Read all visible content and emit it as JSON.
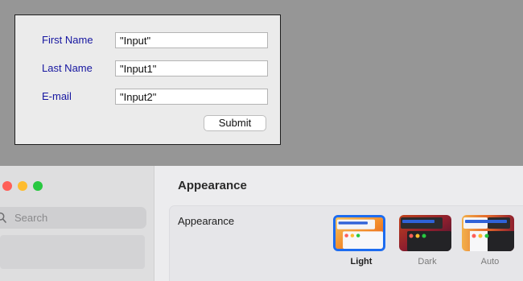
{
  "form": {
    "fields": [
      {
        "label": "First Name",
        "value": "\"Input\""
      },
      {
        "label": "Last Name",
        "value": "\"Input1\""
      },
      {
        "label": "E-mail",
        "value": "\"Input2\""
      }
    ],
    "submit_label": "Submit"
  },
  "settings": {
    "search_placeholder": "Search",
    "title": "Appearance",
    "appearance_label": "Appearance",
    "options": [
      {
        "label": "Light",
        "selected": true
      },
      {
        "label": "Dark",
        "selected": false
      },
      {
        "label": "Auto",
        "selected": false
      }
    ],
    "colors": {
      "accent": "#1d6cf0",
      "form_label": "#1616a0",
      "traffic_red": "#ff5f57",
      "traffic_yellow": "#febc2e",
      "traffic_green": "#28c840"
    }
  }
}
